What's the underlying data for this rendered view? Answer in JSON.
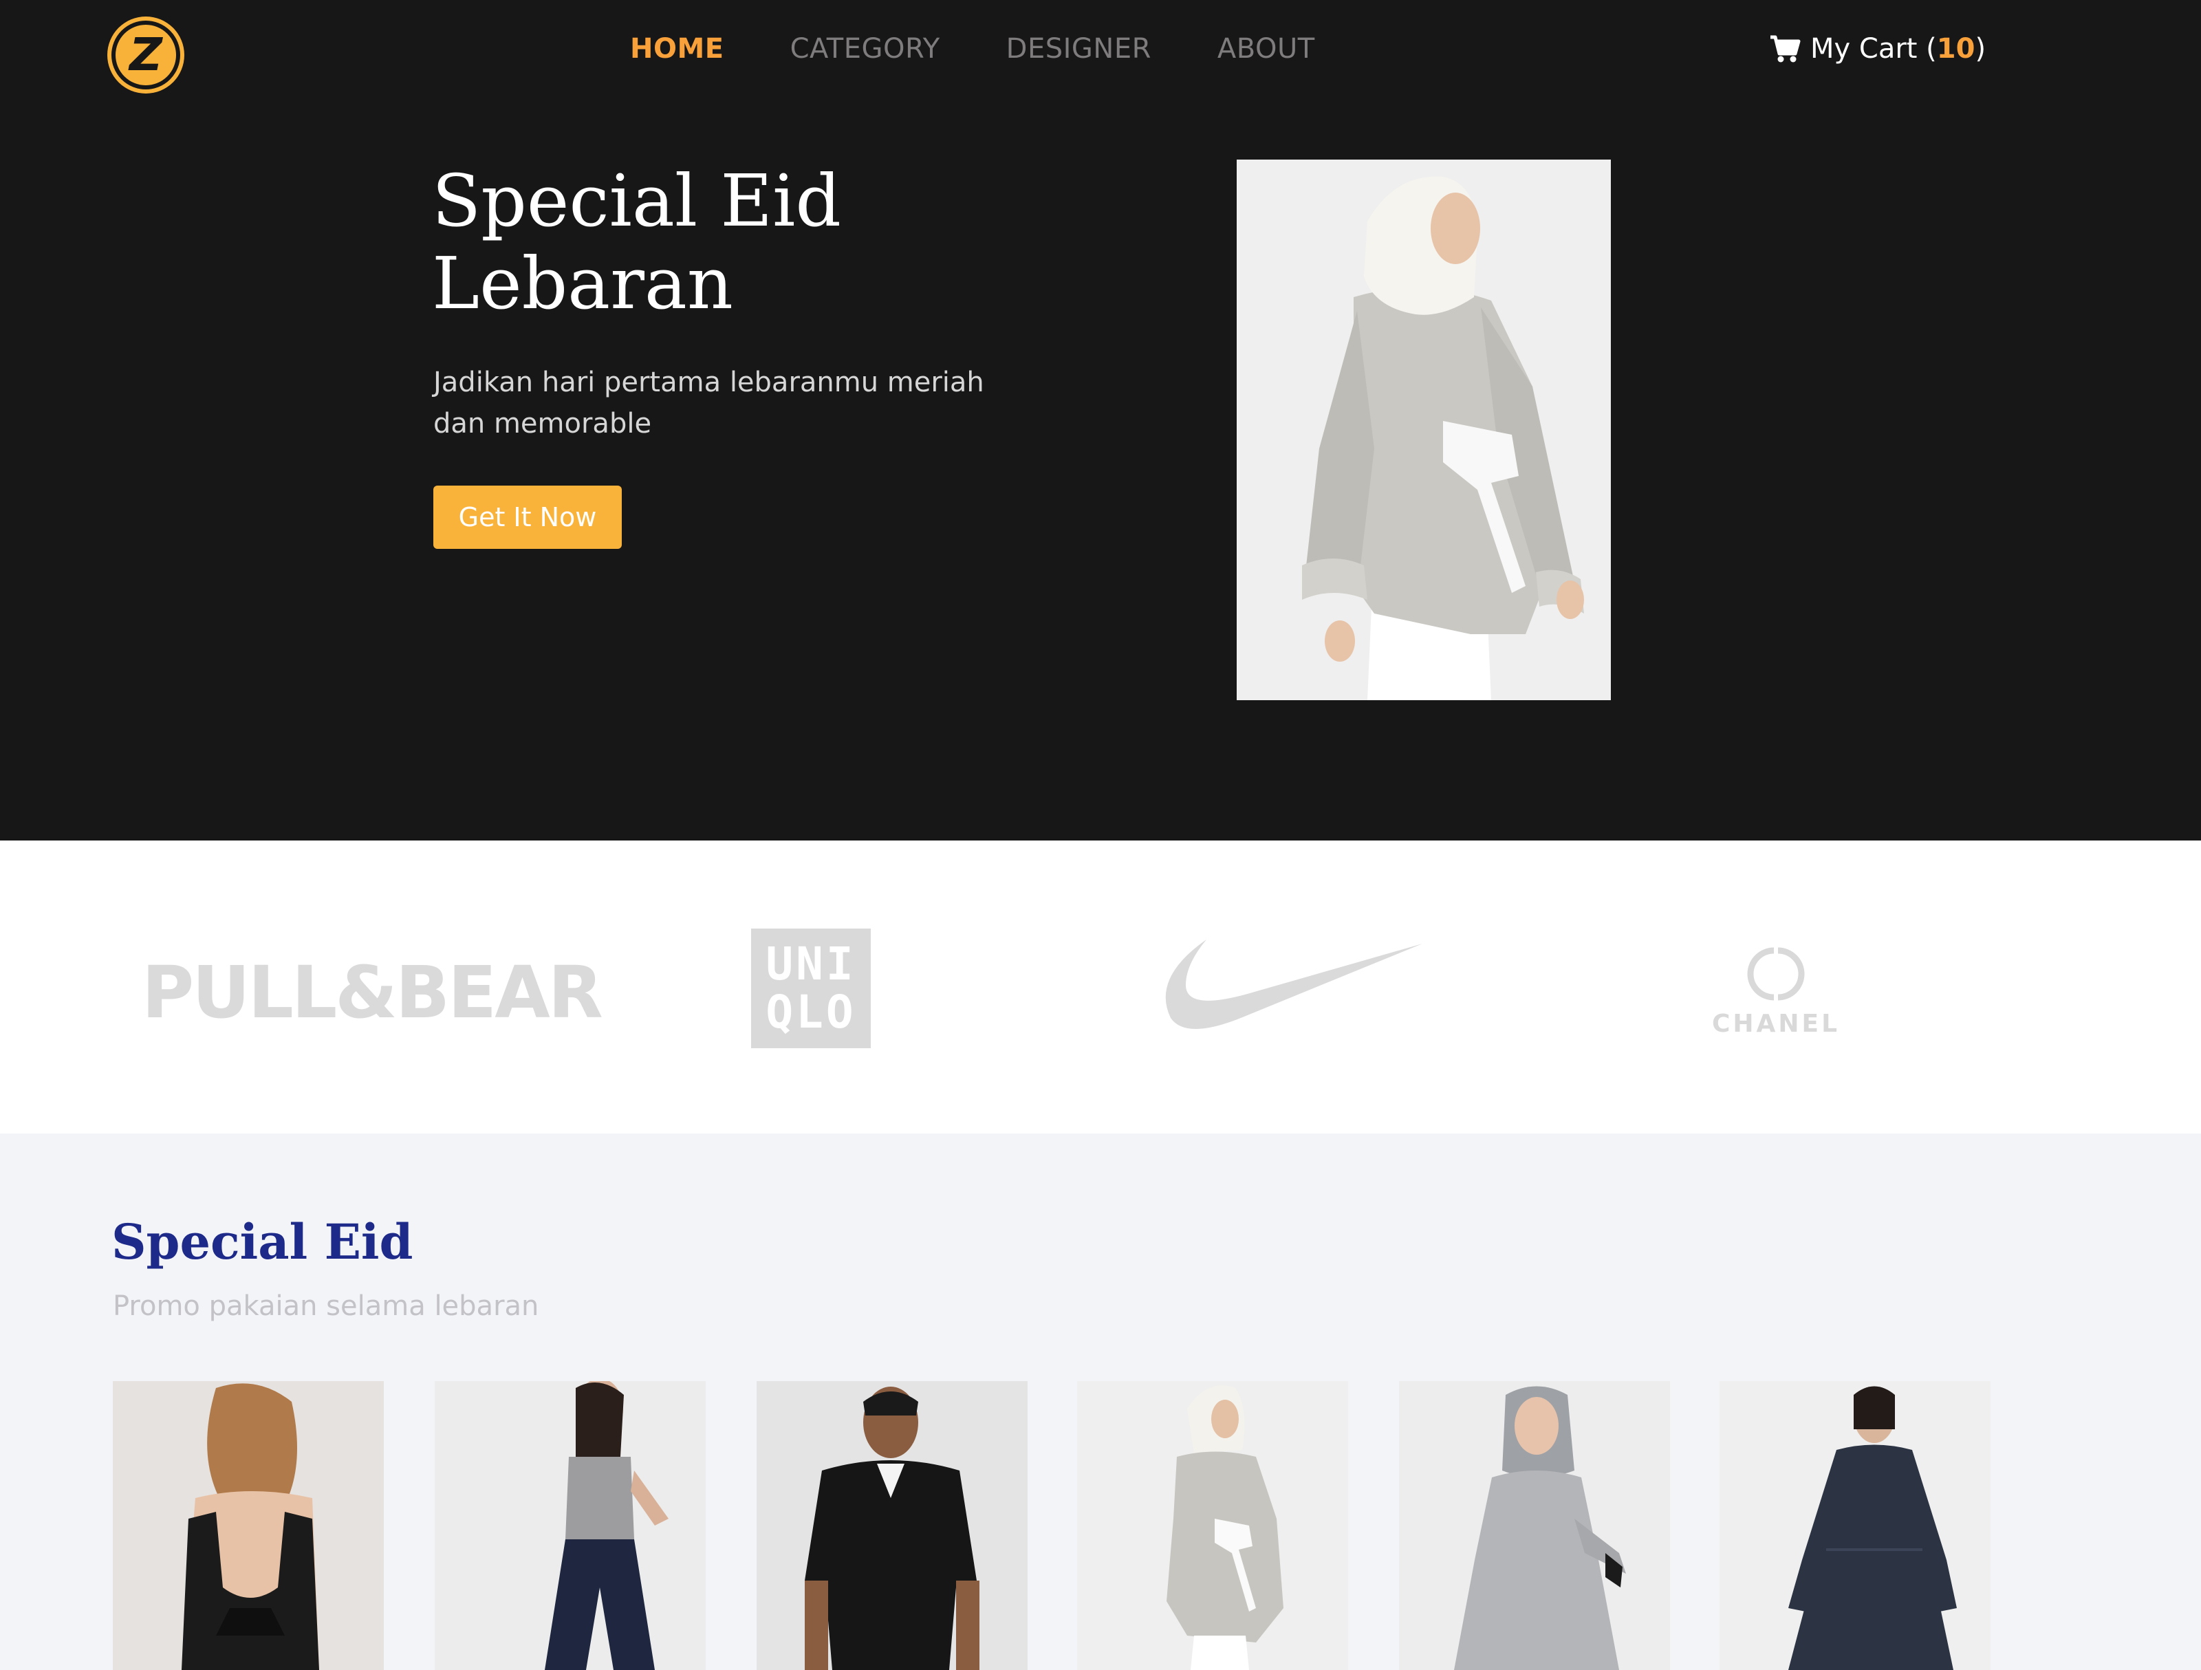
{
  "header": {
    "logo_letter": "Z",
    "nav": [
      {
        "label": "HOME",
        "active": true
      },
      {
        "label": "CATEGORY",
        "active": false
      },
      {
        "label": "DESIGNER",
        "active": false
      },
      {
        "label": "ABOUT",
        "active": false
      }
    ],
    "cart": {
      "label": "My Cart (",
      "count": "10",
      "close": ")"
    }
  },
  "hero": {
    "title": "Special Eid Lebaran",
    "subtitle": "Jadikan hari pertama lebaranmu meriah dan memorable",
    "button_label": "Get It Now"
  },
  "brands": {
    "pullbear": "PULL&BEAR",
    "uniqlo_line1": "UNI",
    "uniqlo_line2": "QLO",
    "chanel": "CHANEL"
  },
  "products_section": {
    "title": "Special Eid",
    "subtitle": "Promo pakaian selama lebaran",
    "items": [
      {
        "name": "black-backless-top"
      },
      {
        "name": "grey-tank-navy-culottes"
      },
      {
        "name": "black-shirt-man"
      },
      {
        "name": "grey-tunic-hijab"
      },
      {
        "name": "grey-dress-hijab"
      },
      {
        "name": "navy-dress"
      }
    ]
  },
  "colors": {
    "accent": "#f8a03a",
    "button": "#f9b33b",
    "hero_bg": "#181718",
    "section_title": "#1d2a8a"
  }
}
